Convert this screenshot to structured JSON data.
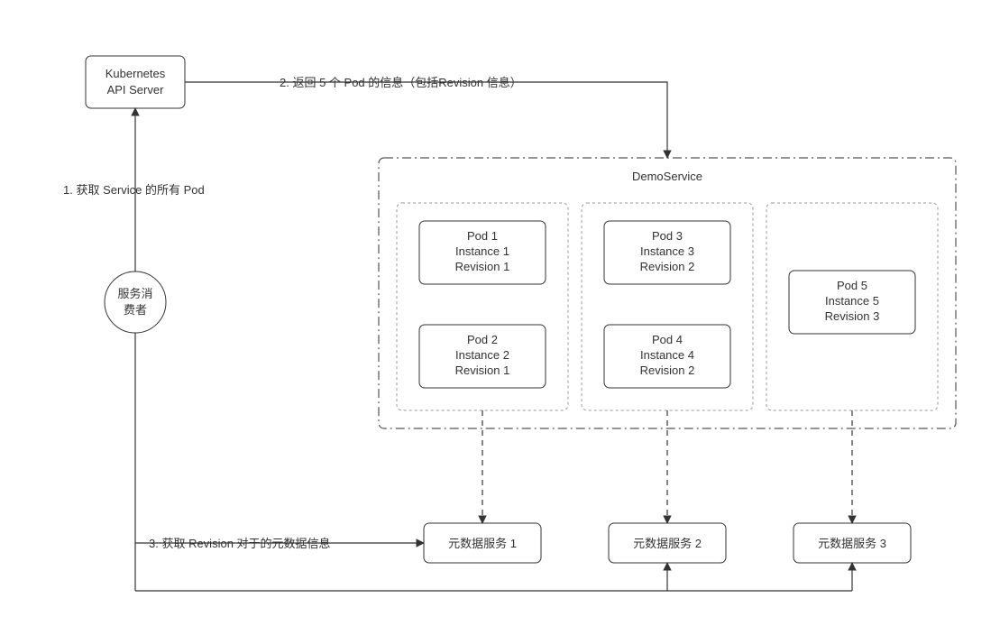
{
  "nodes": {
    "api_server": {
      "line1": "Kubernetes",
      "line2": "API Server"
    },
    "consumer": {
      "line1": "服务消",
      "line2": "费者"
    },
    "demo_service_title": "DemoService",
    "pods": {
      "p1": {
        "l1": "Pod 1",
        "l2": "Instance 1",
        "l3": "Revision 1"
      },
      "p2": {
        "l1": "Pod 2",
        "l2": "Instance 2",
        "l3": "Revision 1"
      },
      "p3": {
        "l1": "Pod 3",
        "l2": "Instance 3",
        "l3": "Revision 2"
      },
      "p4": {
        "l1": "Pod 4",
        "l2": "Instance 4",
        "l3": "Revision 2"
      },
      "p5": {
        "l1": "Pod 5",
        "l2": "Instance 5",
        "l3": "Revision 3"
      }
    },
    "meta": {
      "m1": "元数据服务 1",
      "m2": "元数据服务 2",
      "m3": "元数据服务 3"
    }
  },
  "edges": {
    "e1": "1. 获取 Service 的所有 Pod",
    "e2": "2. 返回 5 个 Pod 的信息（包括Revision 信息）",
    "e3": "3. 获取 Revision 对于的元数据信息"
  }
}
